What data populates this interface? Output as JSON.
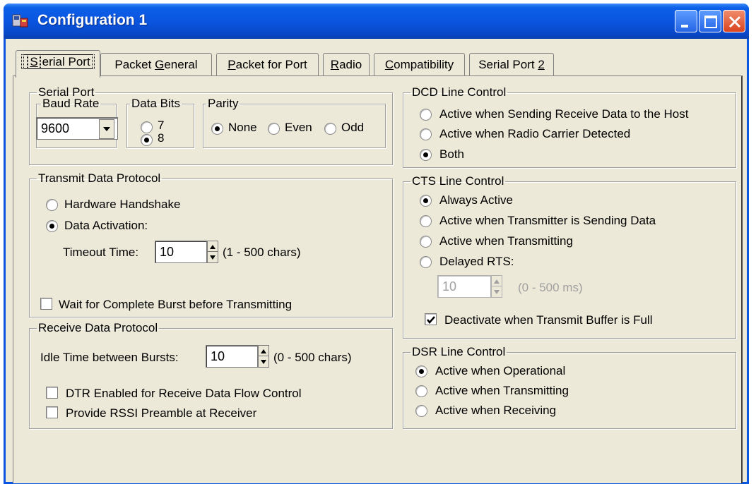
{
  "window": {
    "title": "Configuration 1"
  },
  "tabs": [
    {
      "pre": "",
      "ul": "S",
      "post": "erial Port"
    },
    {
      "pre": "Packet ",
      "ul": "G",
      "post": "eneral"
    },
    {
      "pre": "",
      "ul": "P",
      "post": "acket for Port"
    },
    {
      "pre": "",
      "ul": "R",
      "post": "adio"
    },
    {
      "pre": "",
      "ul": "C",
      "post": "ompatibility"
    },
    {
      "pre": "Serial Port ",
      "ul": "2",
      "post": ""
    }
  ],
  "serial_port": {
    "legend": "Serial Port",
    "baud_rate": {
      "legend": "Baud Rate",
      "value": "9600"
    },
    "data_bits": {
      "legend": "Data Bits",
      "options": [
        "7",
        "8"
      ],
      "selected": "8"
    },
    "parity": {
      "legend": "Parity",
      "options": [
        "None",
        "Even",
        "Odd"
      ],
      "selected": "None"
    }
  },
  "transmit": {
    "legend": "Transmit Data Protocol",
    "options": [
      "Hardware Handshake",
      "Data Activation:"
    ],
    "selected": "Data Activation:",
    "timeout_label": "Timeout Time:",
    "timeout_value": "10",
    "timeout_range": "(1 - 500 chars)",
    "wait_burst_label": "Wait for Complete Burst before Transmitting",
    "wait_burst_checked": false
  },
  "receive": {
    "legend": "Receive Data Protocol",
    "idle_label": "Idle Time between Bursts:",
    "idle_value": "10",
    "idle_range": "(0 - 500 chars)",
    "dtr_label": "DTR Enabled for Receive Data Flow Control",
    "dtr_checked": false,
    "rssi_label": "Provide RSSI Preamble at Receiver",
    "rssi_checked": false
  },
  "dcd": {
    "legend": "DCD Line Control",
    "options": [
      "Active when Sending Receive Data to the Host",
      "Active when Radio Carrier Detected",
      "Both"
    ],
    "selected": "Both"
  },
  "cts": {
    "legend": "CTS Line Control",
    "options": [
      "Always Active",
      "Active when Transmitter is Sending Data",
      "Active when Transmitting",
      "Delayed RTS:"
    ],
    "selected": "Always Active",
    "delay_value": "10",
    "delay_range": "(0 - 500 ms)",
    "deactivate_label": "Deactivate when Transmit Buffer is Full",
    "deactivate_checked": true
  },
  "dsr": {
    "legend": "DSR Line Control",
    "options": [
      "Active when Operational",
      "Active when Transmitting",
      "Active when Receiving"
    ],
    "selected": "Active when Operational"
  },
  "colors": {
    "titlebar": "#0a55e0",
    "dialog_bg": "#ece9d8",
    "close_button": "#d9441f"
  }
}
